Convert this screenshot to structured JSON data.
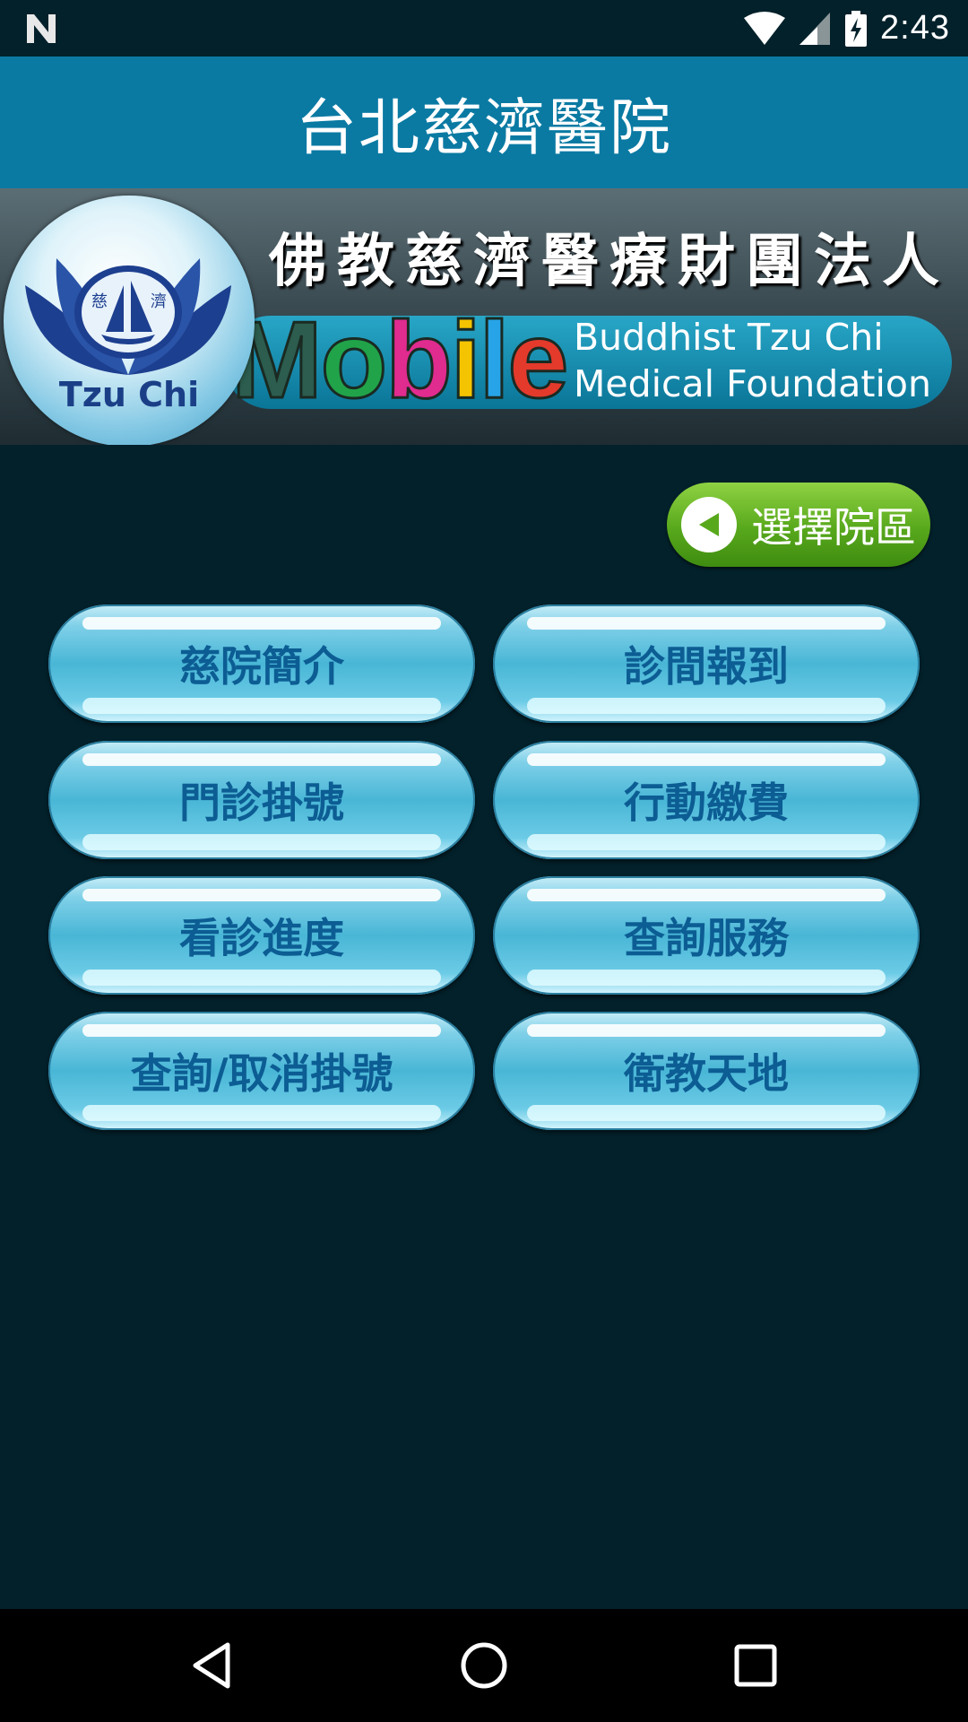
{
  "status_bar": {
    "time": "2:43"
  },
  "app_bar": {
    "title": "台北慈濟醫院"
  },
  "banner": {
    "title_zh": "佛教慈濟醫療財團法人",
    "mobile_letters": [
      "M",
      "o",
      "b",
      "i",
      "l",
      "e"
    ],
    "en_line1": "Buddhist Tzu Chi",
    "en_line2": "Medical Foundation",
    "logo_text": "Tzu Chi",
    "logo_chars": [
      "慈",
      "濟"
    ]
  },
  "select_district": {
    "label": "選擇院區"
  },
  "menu": {
    "items": [
      {
        "label": "慈院簡介"
      },
      {
        "label": "診間報到"
      },
      {
        "label": "門診掛號"
      },
      {
        "label": "行動繳費"
      },
      {
        "label": "看診進度"
      },
      {
        "label": "查詢服務"
      },
      {
        "label": "查詢/取消掛號"
      },
      {
        "label": "衛教天地"
      }
    ]
  },
  "nav_bar": {
    "back": "back-icon",
    "home": "home-icon",
    "recents": "recents-icon"
  }
}
